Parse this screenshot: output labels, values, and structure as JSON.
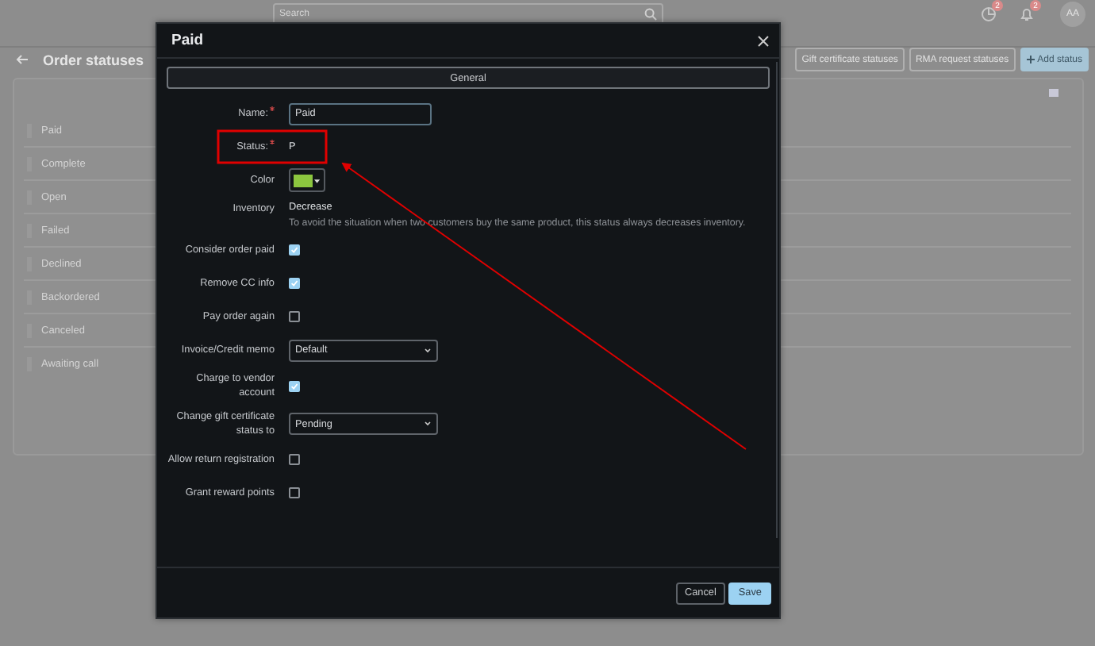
{
  "topbar": {
    "search": {
      "placeholder": "Search"
    },
    "notifications": [
      {
        "kind": "chart",
        "count": "2"
      },
      {
        "kind": "bell",
        "count": "2"
      }
    ],
    "avatar": "AA"
  },
  "page": {
    "title": "Order statuses",
    "buttons": [
      {
        "label": "Gift certificate statuses",
        "kind": "default"
      },
      {
        "label": "RMA request statuses",
        "kind": "default"
      },
      {
        "label": "Add status",
        "kind": "primary"
      }
    ],
    "statuses": [
      "Paid",
      "Complete",
      "Open",
      "Failed",
      "Declined",
      "Backordered",
      "Canceled",
      "Awaiting call"
    ]
  },
  "dialog": {
    "title": "Paid",
    "tabs": [
      {
        "label": "General",
        "selected": true
      }
    ],
    "fields": [
      {
        "kind": "text",
        "label": "Name:",
        "required": true,
        "value": "Paid"
      },
      {
        "kind": "static",
        "label": "Status:",
        "required": true,
        "value": "P"
      },
      {
        "kind": "color",
        "label": "Color",
        "color": "#8cc63f"
      },
      {
        "kind": "info",
        "label": "Inventory",
        "value": "Decrease",
        "note": "To avoid the situation when two customers buy the same product, this status always decreases inventory."
      },
      {
        "kind": "checkbox",
        "label": "Consider order paid",
        "checked": true
      },
      {
        "kind": "checkbox",
        "label": "Remove CC info",
        "checked": true
      },
      {
        "kind": "checkbox",
        "label": "Pay order again",
        "checked": false
      },
      {
        "kind": "select",
        "label": "Invoice/Credit memo",
        "value": "Default"
      },
      {
        "kind": "checkbox",
        "label": "Charge to vendor account",
        "checked": true
      },
      {
        "kind": "select",
        "label": "Change gift certificate status to",
        "value": "Pending"
      },
      {
        "kind": "checkbox",
        "label": "Allow return registration",
        "checked": false
      },
      {
        "kind": "checkbox",
        "label": "Grant reward points",
        "checked": false
      }
    ],
    "buttons": [
      {
        "label": "Cancel",
        "kind": "default"
      },
      {
        "label": "Save",
        "kind": "primary"
      }
    ]
  }
}
